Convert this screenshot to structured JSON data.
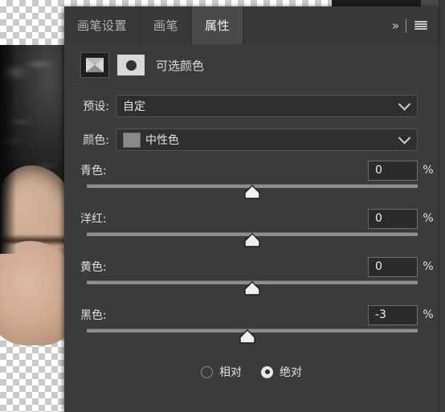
{
  "app": {
    "panel_title": "可选颜色"
  },
  "tabs": [
    {
      "label": "画笔设置",
      "active": false
    },
    {
      "label": "画笔",
      "active": false
    },
    {
      "label": "属性",
      "active": true
    }
  ],
  "tab_icons": {
    "collapse": "»",
    "menu": "hamburger-menu"
  },
  "header": {
    "adjustment_icon": "selective-color-adjustment-icon",
    "mask_icon": "layer-mask-icon",
    "title": "可选颜色"
  },
  "fields": {
    "preset": {
      "label": "预设:",
      "value": "自定"
    },
    "color": {
      "label": "颜色:",
      "value": "中性色",
      "swatch": "#8a8a8a"
    }
  },
  "sliders": [
    {
      "label": "青色:",
      "value": "0",
      "unit": "%",
      "percent": 50
    },
    {
      "label": "洋红:",
      "value": "0",
      "unit": "%",
      "percent": 50
    },
    {
      "label": "黄色:",
      "value": "0",
      "unit": "%",
      "percent": 50
    },
    {
      "label": "黑色:",
      "value": "-3",
      "unit": "%",
      "percent": 48.5
    }
  ],
  "method": {
    "relative": {
      "label": "相对",
      "selected": false
    },
    "absolute": {
      "label": "绝对",
      "selected": true
    }
  },
  "colors": {
    "panel_bg": "#3b3b3b",
    "tab_bg": "#383838",
    "tab_active_bg": "#4a4a4a",
    "input_bg": "#2b2b2b",
    "track": "#8e8e8e",
    "text": "#e2e2e2"
  }
}
